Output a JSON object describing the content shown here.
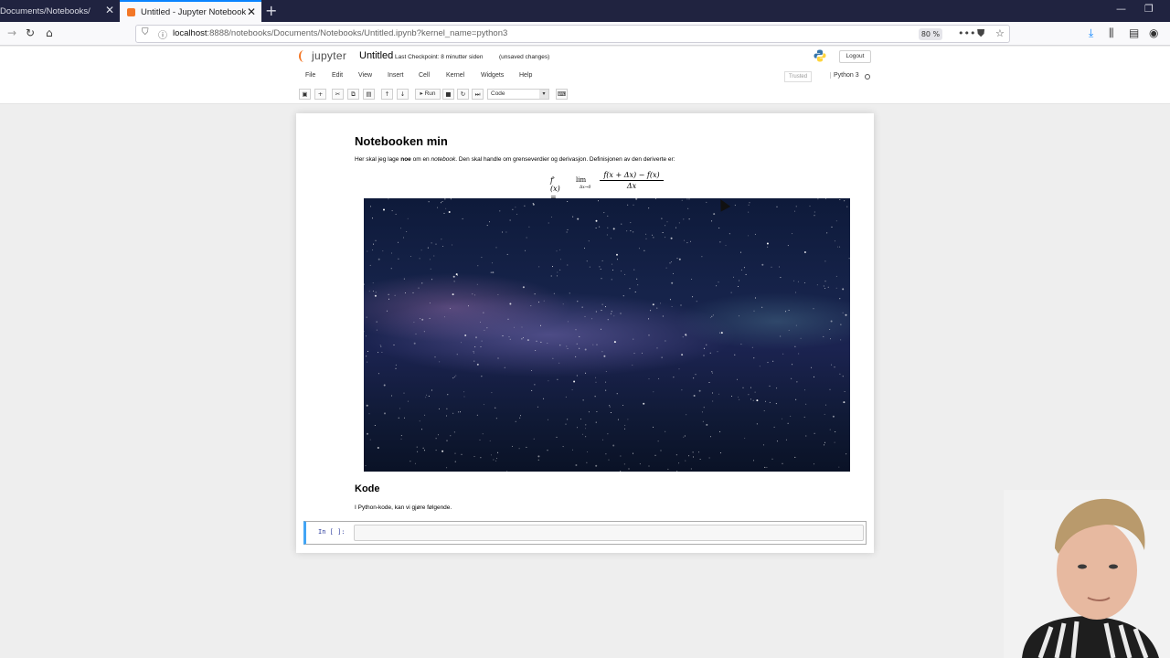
{
  "browser": {
    "tabs": [
      {
        "label": "Documents/Notebooks/",
        "active": false
      },
      {
        "label": "Untitled - Jupyter Notebook",
        "active": true
      }
    ],
    "url": {
      "host": "localhost",
      "path": ":8888/notebooks/Documents/Notebooks/Untitled.ipynb?kernel_name=python3"
    },
    "zoom": "80 %"
  },
  "jupyter": {
    "logo_text": "jupyter",
    "notebook_name": "Untitled",
    "checkpoint": "Last Checkpoint: 8 minutter siden",
    "unsaved": "(unsaved changes)",
    "logout": "Logout",
    "menu": [
      "File",
      "Edit",
      "View",
      "Insert",
      "Cell",
      "Kernel",
      "Widgets",
      "Help"
    ],
    "trusted": "Trusted",
    "kernel": "Python 3",
    "run_label": "Run",
    "cell_type": "Code"
  },
  "notebook": {
    "heading1": "Notebooken min",
    "para_parts": {
      "a": "Her skal jeg lage ",
      "b": "noe",
      "c": " om en ",
      "d": "notebook",
      "e": ". Den skal handle om grenseverdier og derivasjon. Definisjonen av den deriverte er:"
    },
    "formula": {
      "lhs": "f′(x) =",
      "lim": "lim",
      "lim_sub": "Δx→0",
      "numerator": "f(x + Δx) − f(x)",
      "denominator": "Δx"
    },
    "heading2": "Kode",
    "para2": "I Python-kode, kan vi gjøre følgende.",
    "prompt": "In [ ]:"
  },
  "colors": {
    "accent": "#f37726",
    "cell_border": "#42a5f5",
    "tabbar": "#202340"
  }
}
